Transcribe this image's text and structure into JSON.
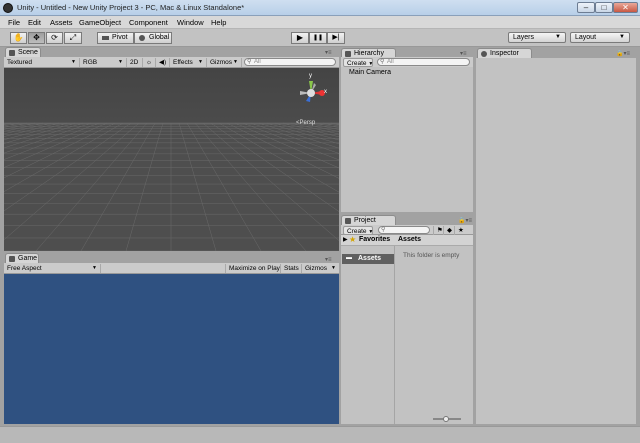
{
  "window": {
    "title": "Unity - Untitled - New Unity Project 3 - PC, Mac & Linux Standalone*",
    "min_label": "–",
    "max_label": "□",
    "close_label": "✕"
  },
  "menu": [
    "File",
    "Edit",
    "Assets",
    "GameObject",
    "Component",
    "Window",
    "Help"
  ],
  "toolbar": {
    "tools": [
      {
        "name": "hand",
        "glyph": "✋"
      },
      {
        "name": "move",
        "glyph": "✥"
      },
      {
        "name": "rotate",
        "glyph": "⟳"
      },
      {
        "name": "scale",
        "glyph": "⤢"
      }
    ],
    "pivot_label": "Pivot",
    "global_label": "Global",
    "play_glyph": "▶",
    "pause_glyph": "❚❚",
    "step_glyph": "▶|",
    "layers_label": "Layers",
    "layout_label": "Layout"
  },
  "scene": {
    "tab_label": "Scene",
    "bar": {
      "shading": "Textured",
      "render_mode": "RGB",
      "mode_2d": "2D",
      "effects": "Effects",
      "gizmos": "Gizmos",
      "search_placeholder": "All"
    },
    "gizmo": {
      "y_label": "y",
      "x_label": "x",
      "persp_label": "<Persp"
    }
  },
  "game": {
    "tab_label": "Game",
    "aspect": "Free Aspect",
    "maximize_on_play": "Maximize on Play",
    "stats": "Stats",
    "gizmos": "Gizmos"
  },
  "hierarchy": {
    "tab_label": "Hierarchy",
    "create_label": "Create",
    "search_placeholder": "All",
    "items": [
      "Main Camera"
    ]
  },
  "project": {
    "tab_label": "Project",
    "create_label": "Create",
    "favorites_label": "Favorites",
    "assets_header": "Assets",
    "assets_folder": "Assets",
    "empty_message": "This folder is empty"
  },
  "inspector": {
    "tab_label": "Inspector"
  }
}
